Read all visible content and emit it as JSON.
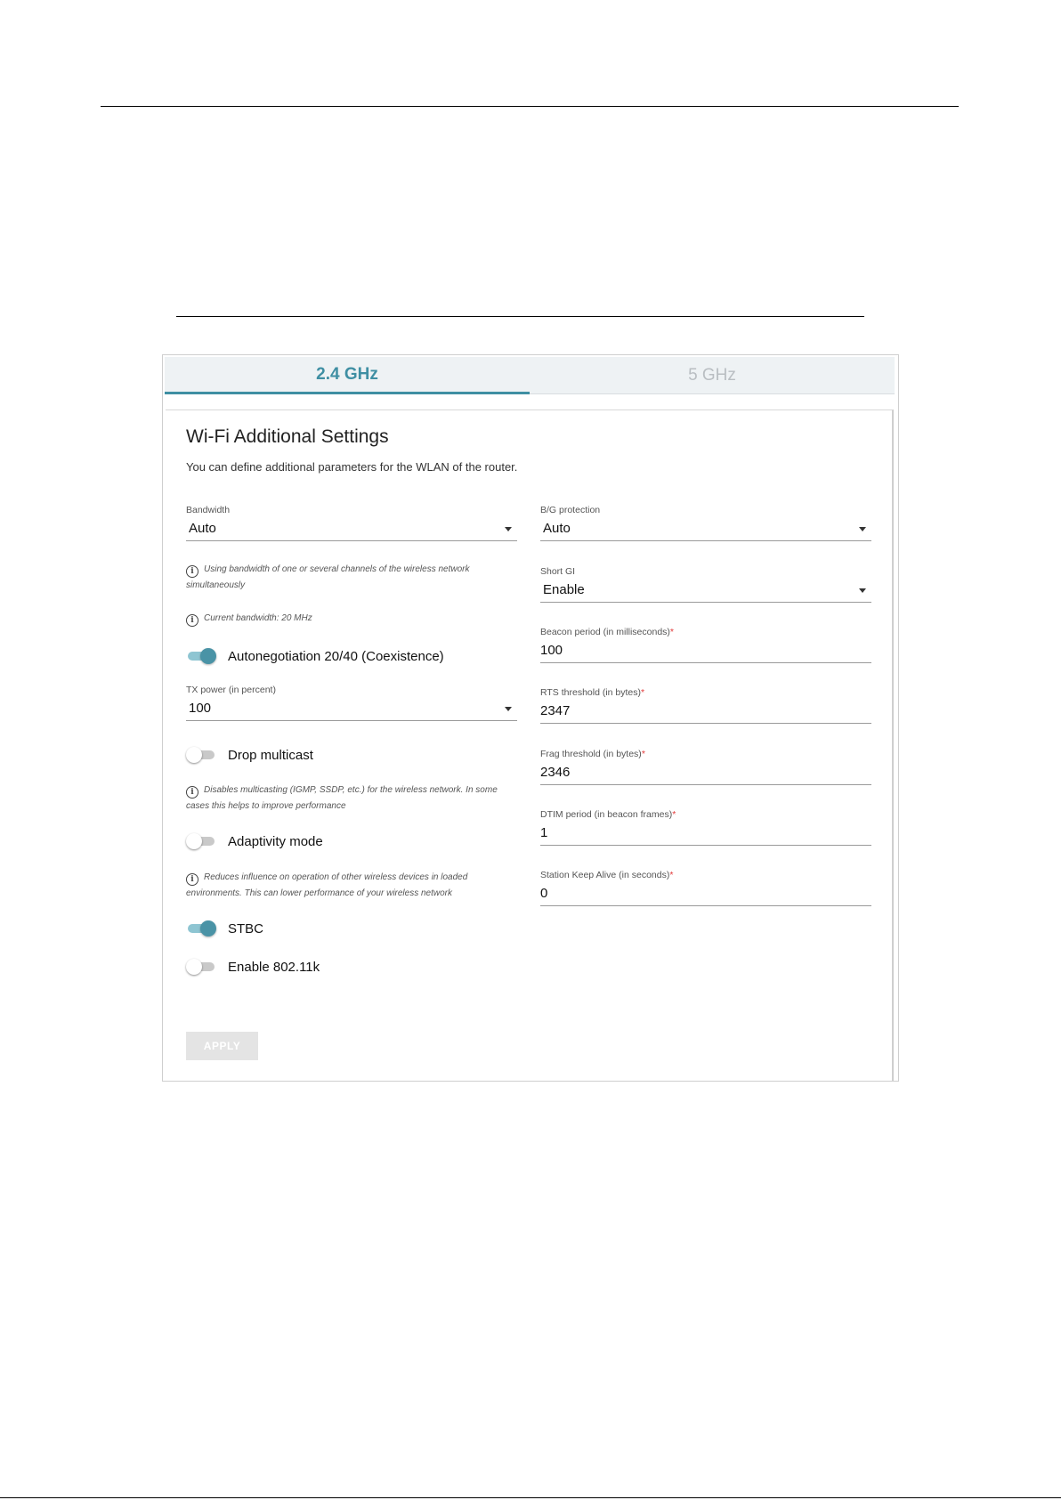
{
  "tabs": [
    {
      "label": "2.4 GHz",
      "active": true
    },
    {
      "label": "5 GHz",
      "active": false
    }
  ],
  "page": {
    "title": "Wi-Fi Additional Settings",
    "subtitle": "You can define additional parameters for the WLAN of the router."
  },
  "left": {
    "bandwidth": {
      "label": "Bandwidth",
      "value": "Auto"
    },
    "bandwidth_hint": "Using bandwidth of one or several channels of the wireless network simultaneously",
    "current_bandwidth": "Current bandwidth: 20 MHz",
    "autonegotiation": {
      "label": "Autonegotiation 20/40 (Coexistence)",
      "on": true
    },
    "tx_power": {
      "label": "TX power (in percent)",
      "value": "100"
    },
    "drop_multicast": {
      "label": "Drop multicast",
      "on": false
    },
    "drop_multicast_hint": "Disables multicasting (IGMP, SSDP, etc.) for the wireless network. In some cases this helps to improve performance",
    "adaptivity": {
      "label": "Adaptivity mode",
      "on": false
    },
    "adaptivity_hint": "Reduces influence on operation of other wireless devices in loaded environments. This can lower performance of your wireless network",
    "stbc": {
      "label": "STBC",
      "on": true
    },
    "enable_80211k": {
      "label": "Enable 802.11k",
      "on": false
    }
  },
  "right": {
    "bg_protection": {
      "label": "B/G protection",
      "value": "Auto"
    },
    "short_gi": {
      "label": "Short GI",
      "value": "Enable"
    },
    "beacon_period": {
      "label": "Beacon period (in milliseconds)",
      "value": "100"
    },
    "rts_threshold": {
      "label": "RTS threshold (in bytes)",
      "value": "2347"
    },
    "frag_threshold": {
      "label": "Frag threshold (in bytes)",
      "value": "2346"
    },
    "dtim_period": {
      "label": "DTIM period (in beacon frames)",
      "value": "1"
    },
    "station_keep_alive": {
      "label": "Station Keep Alive (in seconds)",
      "value": "0"
    }
  },
  "required_mark": "*",
  "info_icon_glyph": "i",
  "apply_label": "APPLY",
  "colors": {
    "accent": "#3f8fa3",
    "toggle_on_knob": "#4a93a6",
    "toggle_on_track": "#8ec5d2",
    "toggle_off_track": "#c9c9c9",
    "required": "#e23a3a",
    "tab_bar": "#eef2f4"
  },
  "icons": {
    "dropdown": "caret-down-icon",
    "info": "info-circle-icon"
  }
}
